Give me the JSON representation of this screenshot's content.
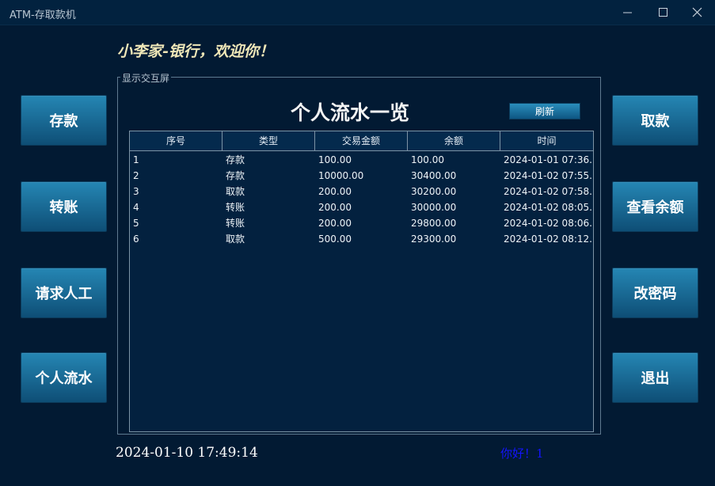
{
  "window": {
    "title": "ATM-存取款机"
  },
  "welcome": "小李家-银行，欢迎你！",
  "left_buttons": [
    "存款",
    "转账",
    "请求人工",
    "个人流水"
  ],
  "right_buttons": [
    "取款",
    "查看余额",
    "改密码",
    "退出"
  ],
  "panel": {
    "group_label": "显示交互屏",
    "title": "个人流水一览",
    "refresh_label": "刷新"
  },
  "table": {
    "columns": [
      "序号",
      "类型",
      "交易金额",
      "余额",
      "时间"
    ],
    "rows": [
      [
        "1",
        "存款",
        "100.00",
        "100.00",
        "2024-01-01 07:36..."
      ],
      [
        "2",
        "存款",
        "10000.00",
        "30400.00",
        "2024-01-02 07:55..."
      ],
      [
        "3",
        "取款",
        "200.00",
        "30200.00",
        "2024-01-02 07:58..."
      ],
      [
        "4",
        "转账",
        "200.00",
        "30000.00",
        "2024-01-02 08:05..."
      ],
      [
        "5",
        "转账",
        "200.00",
        "29800.00",
        "2024-01-02 08:06..."
      ],
      [
        "6",
        "取款",
        "500.00",
        "29300.00",
        "2024-01-02 08:12..."
      ]
    ]
  },
  "footer": {
    "datetime": "2024-01-10 17:49:14",
    "greeting": "你好！1"
  },
  "colors": {
    "background": "#021a33",
    "button_top": "#2586b4",
    "button_bottom": "#0e4e76",
    "welcome_text": "#f0e7b8",
    "greeting_text": "#1414ff"
  },
  "icons": [
    "minimize-icon",
    "maximize-icon",
    "close-icon"
  ]
}
